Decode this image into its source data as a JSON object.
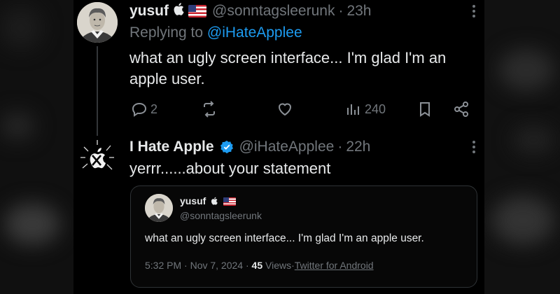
{
  "tweet1": {
    "name": "yusuf",
    "handle": "@sonntagsleerunk",
    "time": "23h",
    "replying_prefix": "Replying to",
    "replying_handle": "@iHateApplee",
    "text": "what an ugly screen interface... I'm glad I'm an apple user.",
    "actions": {
      "replies": "2",
      "views": "240"
    }
  },
  "tweet2": {
    "name": "I Hate Apple",
    "handle": "@iHateApplee",
    "time": "22h",
    "text": "yerrr......about your statement"
  },
  "quote": {
    "name": "yusuf",
    "handle": "@sonntagsleerunk",
    "text": "what an ugly screen interface... I'm glad I'm an apple user.",
    "datetime": "5:32 PM · Nov 7, 2024 ·",
    "views_count": "45",
    "views_label": "Views",
    "source": "Twitter for Android"
  },
  "icons": {
    "reply": "reply-icon",
    "retweet": "retweet-icon",
    "like": "heart-icon",
    "views": "views-chart-icon",
    "bookmark": "bookmark-icon",
    "share": "share-icon",
    "more": "more-vertical-icon",
    "verified": "verified-badge-icon"
  },
  "colors": {
    "background": "#000000",
    "text": "#e7e9ea",
    "muted": "#71767b",
    "link": "#1d9bf0",
    "verified": "#1d9bf0"
  }
}
